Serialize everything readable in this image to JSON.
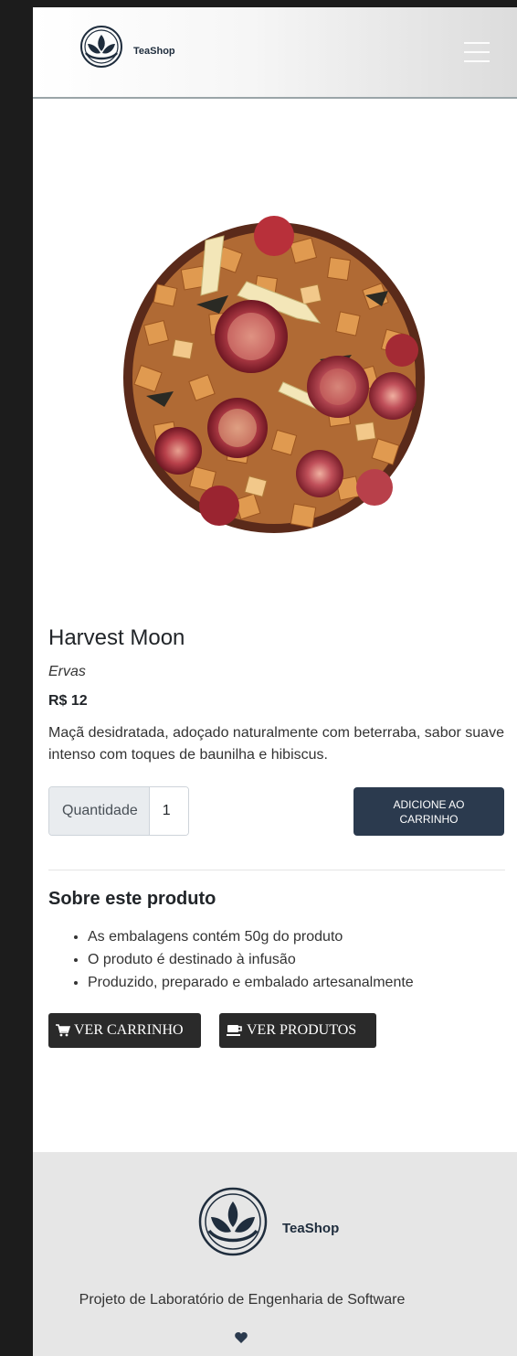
{
  "header": {
    "brand_name": "TeaShop",
    "menu_icon": "hamburger-icon"
  },
  "product": {
    "name": "Harvest Moon",
    "category": "Ervas",
    "price": "R$ 12",
    "description": "Maçã desidratada, adoçado naturalmente com beterraba, sabor suave intenso com toques de baunilha e hibiscus.",
    "quantity_label": "Quantidade",
    "quantity_value": "1",
    "add_to_cart_label": "ADICIONE AO CARRINHO"
  },
  "about": {
    "title": "Sobre este produto",
    "items": [
      "As embalagens contém 50g do produto",
      "O produto é destinado à infusão",
      "Produzido, preparado e embalado artesanalmente"
    ]
  },
  "actions": {
    "view_cart_label": "VER CARRINHO",
    "view_cart_icon": "shopping-cart-icon",
    "view_products_label": "VER PRODUTOS",
    "view_products_icon": "tea-cup-icon"
  },
  "footer": {
    "brand_name": "TeaShop",
    "project_text": "Projeto de Laboratório de Engenharia de Software",
    "heart_icon": "heart-icon"
  },
  "colors": {
    "primary_dark": "#2b3a4e",
    "button_dark": "#2a2a2a",
    "footer_bg": "#e6e6e6",
    "brand_navy": "#1f2d3d"
  }
}
